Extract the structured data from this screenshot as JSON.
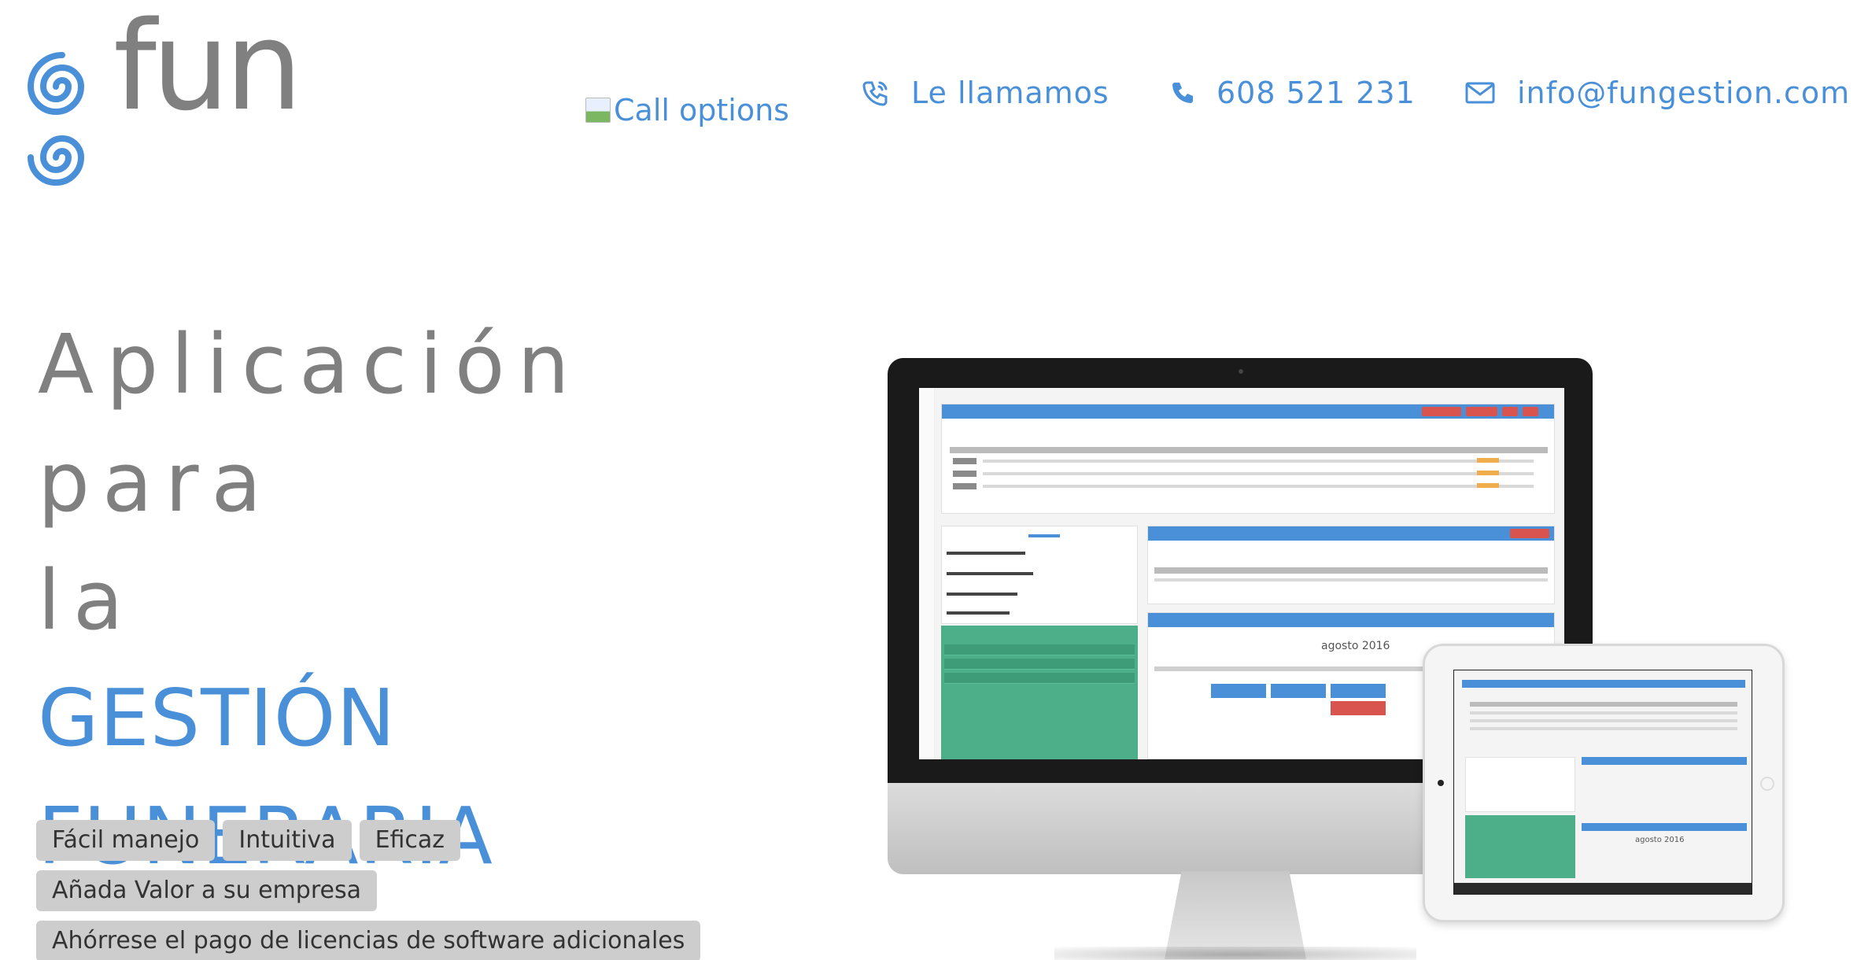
{
  "header": {
    "logo_text": "fun",
    "call_options_alt": "Call options",
    "callback_label": "Le llamamos",
    "phone": "608 521 231",
    "email": "info@fungestion.com"
  },
  "hero": {
    "line1": "Aplicación para",
    "line2": "la",
    "line3": "GESTIÓN",
    "line4": "FUNERARIA"
  },
  "tags": [
    "Fácil manejo",
    "Intuitiva",
    "Eficaz",
    "Añada Valor a su empresa",
    "Ahórrese el pago de licencias de software adicionales"
  ],
  "screen": {
    "calendar_month": "agosto 2016",
    "ipad_calendar_month": "agosto 2016"
  },
  "colors": {
    "accent": "#4a90d9",
    "gray_text": "#808080",
    "tag_bg": "#cdcdcd"
  }
}
